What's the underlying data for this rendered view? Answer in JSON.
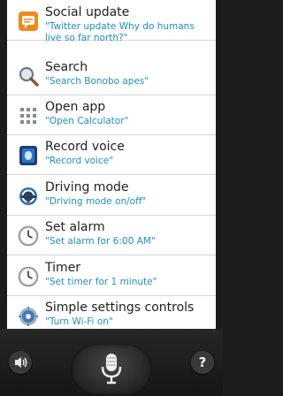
{
  "commands": [
    {
      "title": "Social update",
      "subtitle": "\"Twitter update Why do humans live so far north?\"",
      "icon": "social-update-icon"
    },
    {
      "title": "Search",
      "subtitle": "\"Search Bonobo apes\"",
      "icon": "search-icon"
    },
    {
      "title": "Open app",
      "subtitle": "\"Open Calculator\"",
      "icon": "app-grid-icon"
    },
    {
      "title": "Record voice",
      "subtitle": "\"Record voice\"",
      "icon": "record-voice-icon"
    },
    {
      "title": "Driving mode",
      "subtitle": "\"Driving mode on/off\"",
      "icon": "steering-wheel-icon"
    },
    {
      "title": "Set alarm",
      "subtitle": "\"Set alarm for 6:00 AM\"",
      "icon": "clock-icon"
    },
    {
      "title": "Timer",
      "subtitle": "\"Set timer for 1 minute\"",
      "icon": "clock-icon"
    },
    {
      "title": "Simple settings controls",
      "subtitle": "\"Turn Wi-Fi on\"",
      "icon": "settings-gear-icon"
    }
  ],
  "bottom_bar": {
    "mic_icon": "microphone-icon",
    "left_icon": "speaker-icon",
    "right_icon": "help-icon",
    "help_label": "?"
  },
  "colors": {
    "subtitle": "#1f8fc4",
    "title": "#1f1f1f",
    "background": "#1c1c1c",
    "sheet": "#ffffff"
  }
}
